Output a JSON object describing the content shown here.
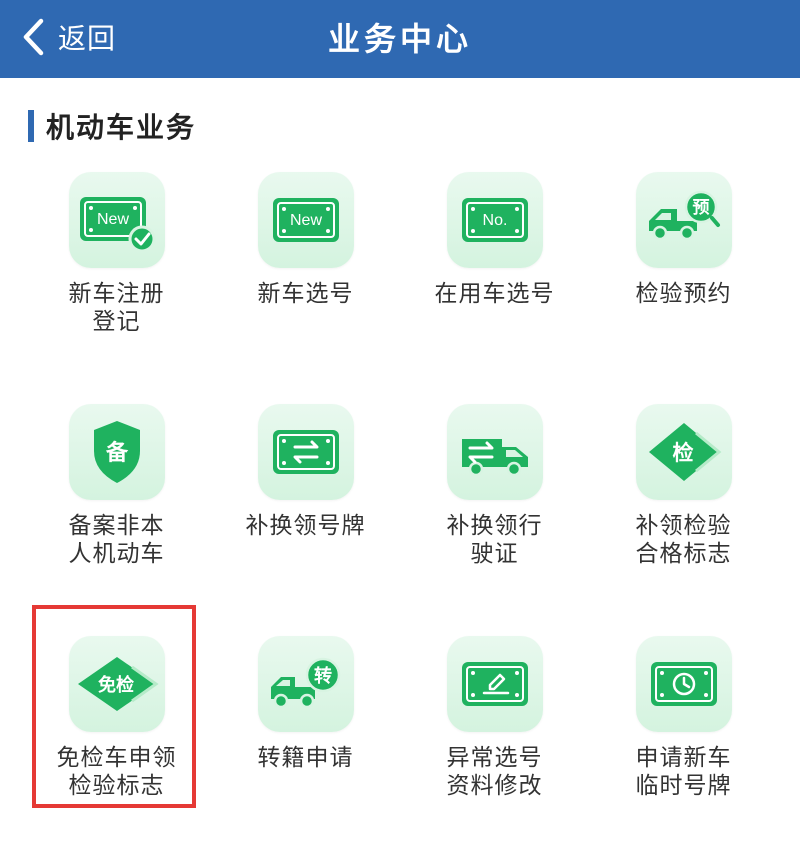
{
  "header": {
    "back_label": "返回",
    "title": "业务中心"
  },
  "section": {
    "title": "机动车业务"
  },
  "colors": {
    "header_bg": "#2f69b2",
    "icon_green": "#1fb25f",
    "highlight": "#e53935"
  },
  "services": [
    {
      "icon": "plate-new-check-icon",
      "label": "新车注册\n登记",
      "plate_text": "New"
    },
    {
      "icon": "plate-new-icon",
      "label": "新车选号",
      "plate_text": "New"
    },
    {
      "icon": "plate-number-icon",
      "label": "在用车选号",
      "plate_text": "No."
    },
    {
      "icon": "truck-reserve-icon",
      "label": "检验预约",
      "badge_text": "预"
    },
    {
      "icon": "shield-icon",
      "label": "备案非本\n人机动车",
      "badge_text": "备"
    },
    {
      "icon": "plate-swap-icon",
      "label": "补换领号牌"
    },
    {
      "icon": "truck-swap-icon",
      "label": "补换领行\n驶证"
    },
    {
      "icon": "inspection-diamond-icon",
      "label": "补领检验\n合格标志",
      "badge_text": "检"
    },
    {
      "icon": "exempt-inspection-icon",
      "label": "免检车申领\n检验标志",
      "badge_text": "免检",
      "highlighted": true
    },
    {
      "icon": "truck-transfer-icon",
      "label": "转籍申请",
      "badge_text": "转"
    },
    {
      "icon": "plate-edit-icon",
      "label": "异常选号\n资料修改"
    },
    {
      "icon": "plate-clock-icon",
      "label": "申请新车\n临时号牌"
    }
  ]
}
